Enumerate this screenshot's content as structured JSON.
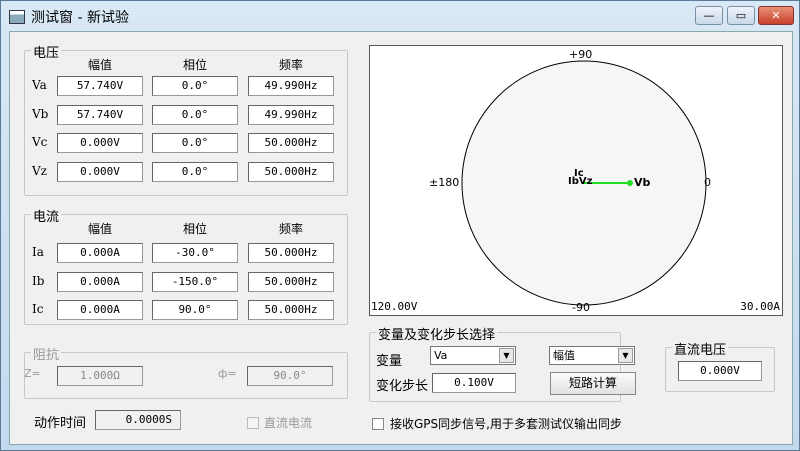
{
  "window": {
    "title": "测试窗 - 新试验",
    "minimize": "—",
    "maximize": "▭",
    "close": "✕"
  },
  "voltage": {
    "title": "电压",
    "headers": [
      "幅值",
      "相位",
      "频率"
    ],
    "rows": [
      {
        "label": "Va",
        "amp": "57.740V",
        "phase": "0.0°",
        "freq": "49.990Hz"
      },
      {
        "label": "Vb",
        "amp": "57.740V",
        "phase": "0.0°",
        "freq": "49.990Hz"
      },
      {
        "label": "Vc",
        "amp": "0.000V",
        "phase": "0.0°",
        "freq": "50.000Hz"
      },
      {
        "label": "Vz",
        "amp": "0.000V",
        "phase": "0.0°",
        "freq": "50.000Hz"
      }
    ]
  },
  "current": {
    "title": "电流",
    "headers": [
      "幅值",
      "相位",
      "频率"
    ],
    "rows": [
      {
        "label": "Ia",
        "amp": "0.000A",
        "phase": "-30.0°",
        "freq": "50.000Hz"
      },
      {
        "label": "Ib",
        "amp": "0.000A",
        "phase": "-150.0°",
        "freq": "50.000Hz"
      },
      {
        "label": "Ic",
        "amp": "0.000A",
        "phase": "90.0°",
        "freq": "50.000Hz"
      }
    ]
  },
  "impedance": {
    "title": "阻抗",
    "z_label": "Z=",
    "z_value": "1.000Ω",
    "phi_label": "ф=",
    "phi_value": "90.0°"
  },
  "action_time": {
    "label": "动作时间",
    "value": "0.0000S"
  },
  "dc_current": {
    "label": "直流电流",
    "checked": false
  },
  "phasor": {
    "top": "+90",
    "bottom": "-90",
    "left": "±180",
    "right": "0",
    "v_scale": "120.00V",
    "i_scale": "30.00A",
    "labels": {
      "ic": "Ic",
      "ib_vz": "IbVz",
      "vb": "Vb"
    },
    "vector_color": "#22dd22"
  },
  "variable": {
    "title": "变量及变化步长选择",
    "var_label": "变量",
    "var_value": "Va",
    "type_value": "幅值",
    "step_label": "变化步长",
    "step_value": "0.100V",
    "short_button": "短路计算"
  },
  "dc_voltage": {
    "title": "直流电压",
    "value": "0.000V"
  },
  "gps": {
    "label": "接收GPS同步信号,用于多套测试仪输出同步",
    "checked": false
  }
}
